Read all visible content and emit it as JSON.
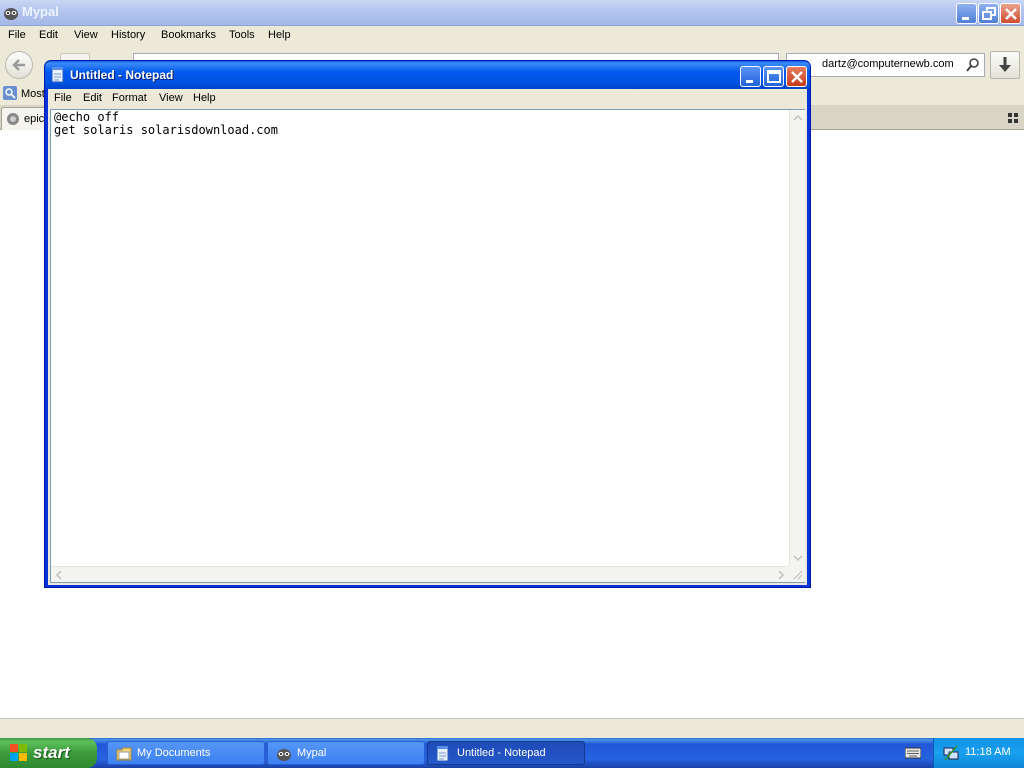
{
  "browser": {
    "title": "Mypal",
    "menu": [
      "File",
      "Edit",
      "View",
      "History",
      "Bookmarks",
      "Tools",
      "Help"
    ],
    "search": {
      "value": "dartz@computernewb.com"
    },
    "bookmarks": {
      "item": "Most"
    },
    "tabs": [
      {
        "label": "epic"
      }
    ]
  },
  "notepad": {
    "title": "Untitled - Notepad",
    "menu": [
      "File",
      "Edit",
      "Format",
      "View",
      "Help"
    ],
    "content": "@echo off\nget solaris solarisdownload.com"
  },
  "taskbar": {
    "start_label": "start",
    "buttons": [
      {
        "label": "My Documents",
        "icon": "folder-icon",
        "active": false
      },
      {
        "label": "Mypal",
        "icon": "mypal-icon",
        "active": false
      },
      {
        "label": "Untitled - Notepad",
        "icon": "notepad-icon",
        "active": true
      }
    ],
    "clock": "11:18 AM"
  },
  "colors": {
    "xp_title_blue": "#0058ee",
    "taskbar_blue": "#2663e0",
    "start_green": "#3c9b3c",
    "tray_blue": "#19a0f0",
    "close_red": "#c43a1a"
  }
}
